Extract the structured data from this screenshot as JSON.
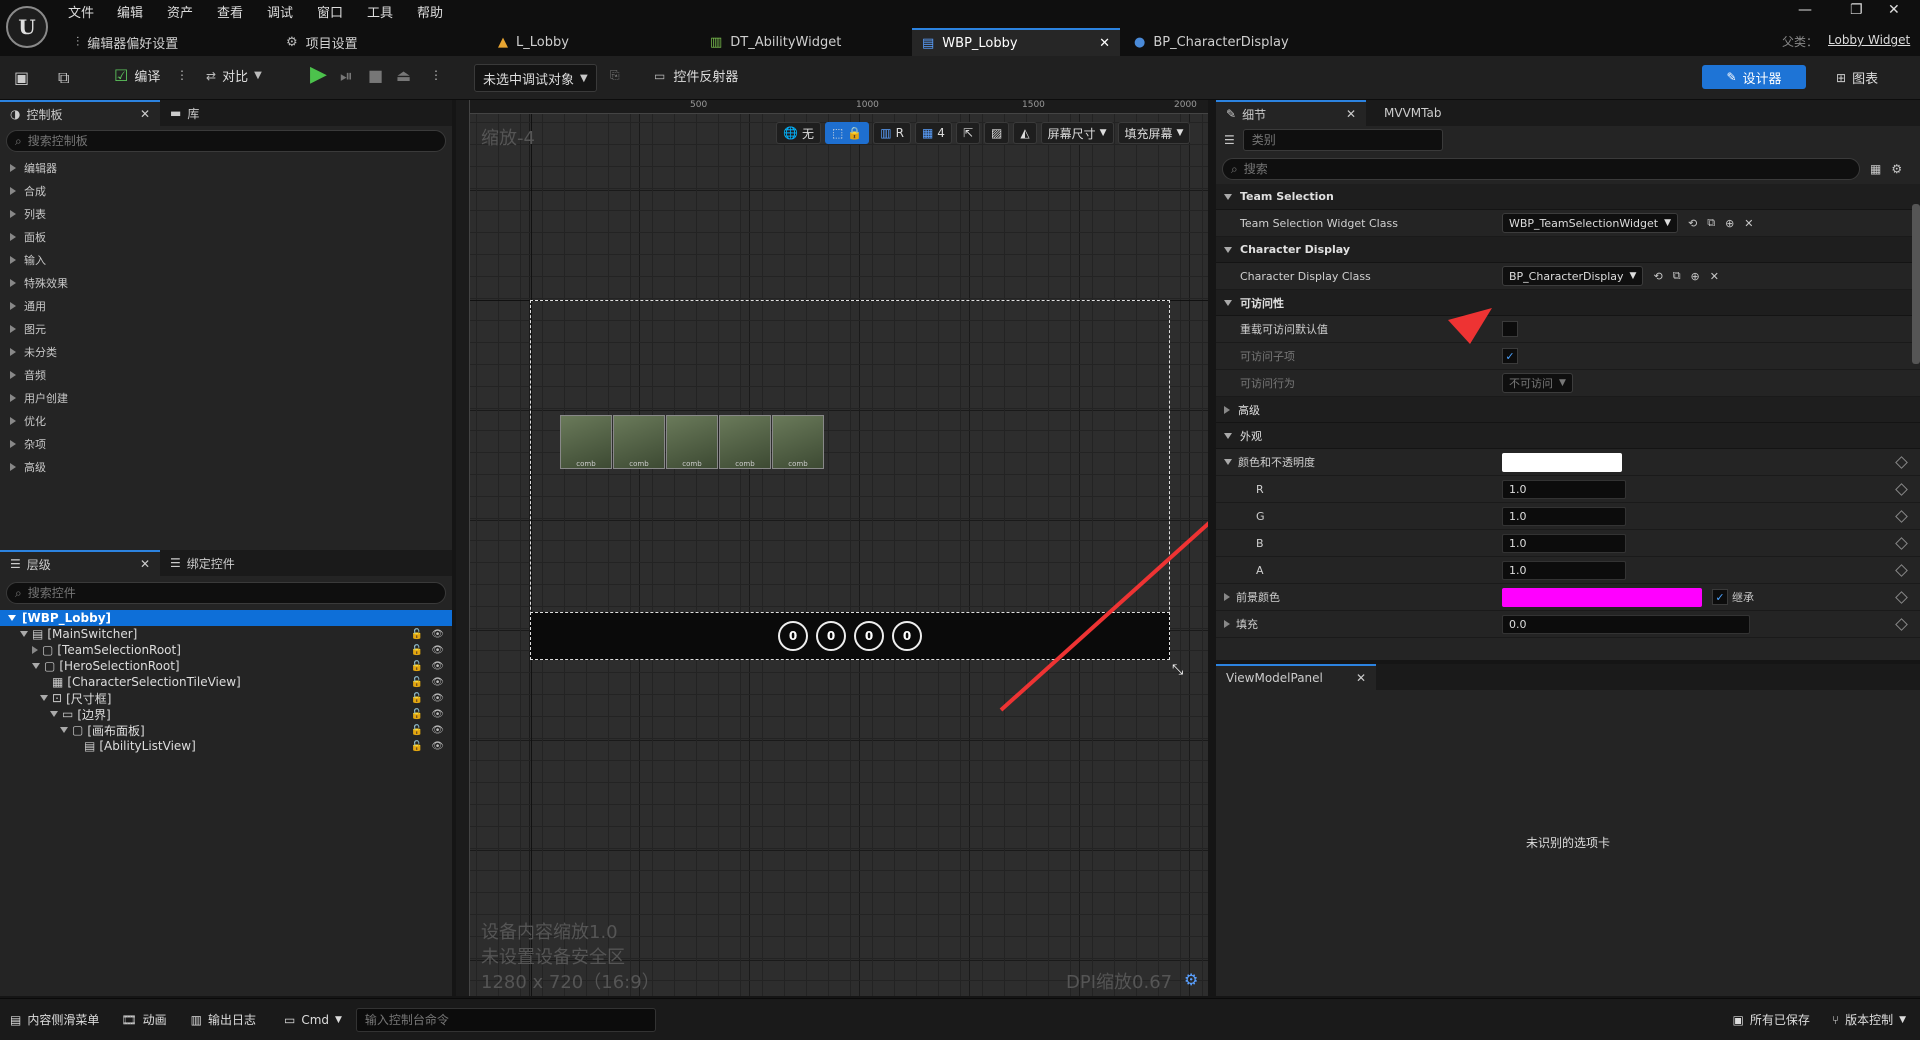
{
  "menu": [
    "文件",
    "编辑",
    "资产",
    "查看",
    "调试",
    "窗口",
    "工具",
    "帮助"
  ],
  "tabs": [
    {
      "label": "编辑器偏好设置"
    },
    {
      "label": "项目设置"
    },
    {
      "label": "L_Lobby"
    },
    {
      "label": "DT_AbilityWidget"
    },
    {
      "label": "WBP_Lobby"
    },
    {
      "label": "BP_CharacterDisplay"
    }
  ],
  "parent": {
    "label": "父类：",
    "value": "Lobby Widget"
  },
  "toolbar": {
    "compile": "编译",
    "diff": "对比",
    "debug_target": "未选中调试对象",
    "reflector": "控件反射器",
    "designer": "设计器",
    "graph": "图表"
  },
  "palette": {
    "tab": "控制板",
    "lib_tab": "库",
    "search_placeholder": "搜索控制板",
    "items": [
      "编辑器",
      "合成",
      "列表",
      "面板",
      "输入",
      "特殊效果",
      "通用",
      "图元",
      "未分类",
      "音频",
      "用户创建",
      "优化",
      "杂项",
      "高级"
    ]
  },
  "hierarchy": {
    "tab": "层级",
    "bind_tab": "绑定控件",
    "search_placeholder": "搜索控件",
    "root": "[WBP_Lobby]",
    "items": [
      "[MainSwitcher]",
      "[TeamSelectionRoot]",
      "[HeroSelectionRoot]",
      "[CharacterSelectionTileView]",
      "[尺寸框]",
      "[边界]",
      "[画布面板]",
      "[AbilityListView]"
    ]
  },
  "canvas": {
    "zoom": "缩放-4",
    "ruler": [
      "500",
      "1000",
      "1500",
      "2000"
    ],
    "tool_none": "无",
    "tool_r": "R",
    "grid_num": "4",
    "screen_size": "屏幕尺寸",
    "fill_screen": "填充屏幕",
    "device_scale": "设备内容缩放1.0",
    "safe_zone": "未设置设备安全区",
    "resolution": "1280 x 720（16:9）",
    "dpi": "DPI缩放0.67",
    "counters": [
      "0",
      "0",
      "0",
      "0"
    ],
    "thumb_caption": "comb"
  },
  "details": {
    "tab": "细节",
    "mvvm_tab": "MVVMTab",
    "category_placeholder": "类别",
    "search_placeholder": "搜索",
    "sections": {
      "team": "Team Selection",
      "character": "Character Display",
      "access": "可访问性",
      "advanced": "高级",
      "appearance": "外观"
    },
    "team_class_label": "Team Selection Widget Class",
    "team_class_value": "WBP_TeamSelectionWidget",
    "char_class_label": "Character Display Class",
    "char_class_value": "BP_CharacterDisplay",
    "access_override": "重载可访问默认值",
    "access_children": "可访问子项",
    "access_behavior": "可访问行为",
    "access_behavior_value": "不可访问",
    "color_opacity": "颜色和不透明度",
    "r_label": "R",
    "r_value": "1.0",
    "g_label": "G",
    "g_value": "1.0",
    "b_label": "B",
    "b_value": "1.0",
    "a_label": "A",
    "a_value": "1.0",
    "fg_color": "前景颜色",
    "inherit": "继承",
    "padding": "填充",
    "padding_value": "0.0",
    "fg_hex": "#ff00ff"
  },
  "viewmodel": {
    "tab": "ViewModelPanel",
    "message": "未识别的选项卡"
  },
  "status": {
    "content_drawer": "内容侧滑菜单",
    "animation": "动画",
    "output_log": "输出日志",
    "cmd": "Cmd",
    "console_placeholder": "输入控制台命令",
    "all_saved": "所有已保存",
    "version_control": "版本控制"
  }
}
